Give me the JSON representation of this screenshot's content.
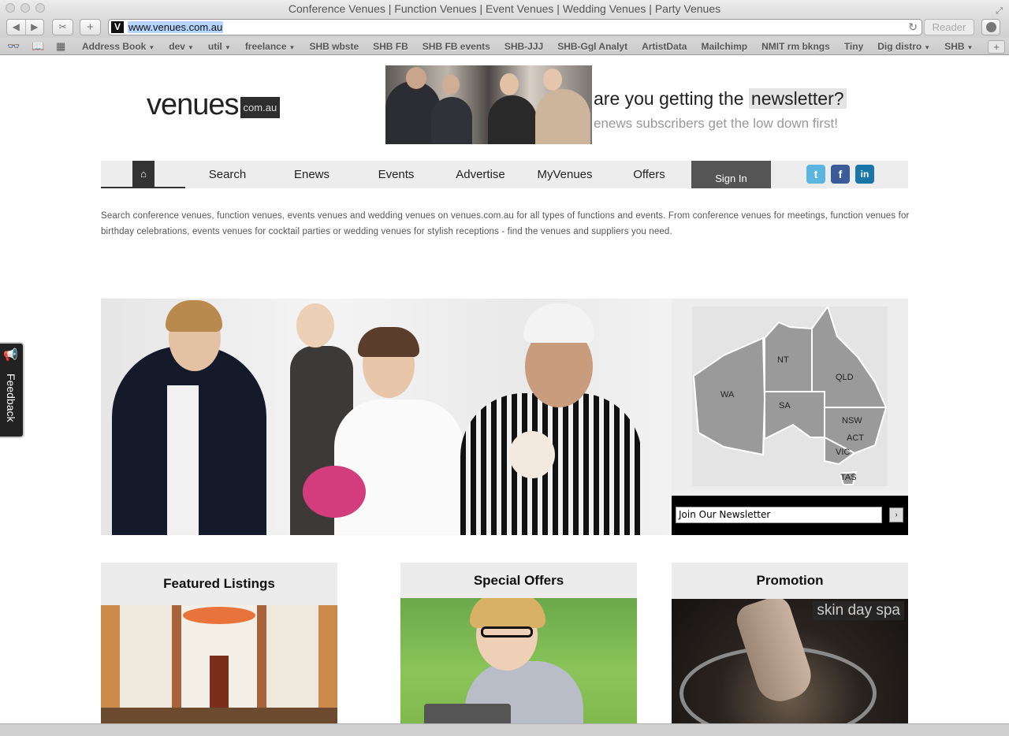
{
  "browser": {
    "window_title": "Conference Venues | Function Venues | Event Venues | Wedding Venues | Party Venues",
    "url": "www.venues.com.au",
    "reader_label": "Reader",
    "bookmarks": [
      {
        "label": "Address Book",
        "dropdown": true
      },
      {
        "label": "dev",
        "dropdown": true
      },
      {
        "label": "util",
        "dropdown": true
      },
      {
        "label": "freelance",
        "dropdown": true
      },
      {
        "label": "SHB wbste",
        "dropdown": false
      },
      {
        "label": "SHB FB",
        "dropdown": false
      },
      {
        "label": "SHB FB events",
        "dropdown": false
      },
      {
        "label": "SHB-JJJ",
        "dropdown": false
      },
      {
        "label": "SHB-Ggl Analyt",
        "dropdown": false
      },
      {
        "label": "ArtistData",
        "dropdown": false
      },
      {
        "label": "Mailchimp",
        "dropdown": false
      },
      {
        "label": "NMIT rm bkngs",
        "dropdown": false
      },
      {
        "label": "Tiny",
        "dropdown": false
      },
      {
        "label": "Dig distro",
        "dropdown": true
      },
      {
        "label": "SHB",
        "dropdown": true
      }
    ]
  },
  "site": {
    "logo_word": "venues",
    "logo_suffix": "com.au",
    "banner": {
      "line1_prefix": "are you getting the",
      "line1_highlight": "newsletter?",
      "line2": "enews subscribers get the low down first!"
    },
    "nav": {
      "home_icon": "home-icon",
      "items": [
        "Search",
        "Enews",
        "Events",
        "Advertise",
        "MyVenues",
        "Offers"
      ],
      "signin": "Sign In",
      "social": [
        "twitter-icon",
        "facebook-icon",
        "linkedin-icon"
      ]
    },
    "intro": "Search conference venues, function venues, events venues and wedding venues on venues.com.au for all types of functions and events. From conference venues for meetings, function venues for birthday celebrations, events venues for cocktail parties or wedding venues for stylish receptions - find the venues and suppliers you need.",
    "map": {
      "states": [
        "WA",
        "NT",
        "SA",
        "QLD",
        "NSW",
        "ACT",
        "VIC",
        "TAS"
      ]
    },
    "newsletter": {
      "value": "Join Our Newsletter",
      "button": "›"
    },
    "feedback": "Feedback",
    "cards": [
      {
        "title": "Featured Listings"
      },
      {
        "title": "Special Offers"
      },
      {
        "title": "Promotion",
        "image_text": "skin day spa"
      }
    ],
    "colors": {
      "nav_bg": "#ededed",
      "signin_bg": "#555555",
      "newsletter_bg": "#000000",
      "card_head_bg": "#ececec"
    }
  }
}
